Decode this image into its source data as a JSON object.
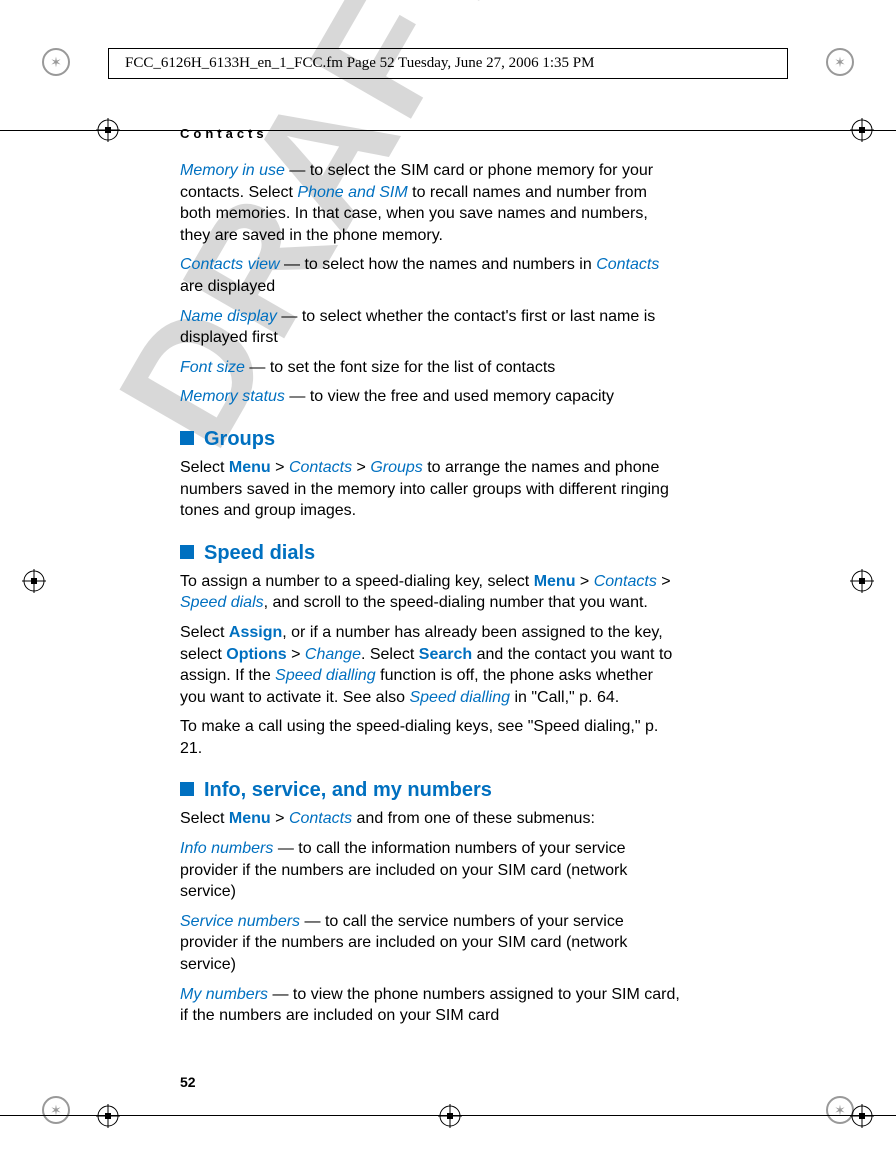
{
  "header": {
    "doc_line": "FCC_6126H_6133H_en_1_FCC.fm  Page 52  Tuesday, June 27, 2006  1:35 PM"
  },
  "section_header": "Contacts",
  "watermark": "DRAFT",
  "page_number": "52",
  "body": {
    "memory_in_use": {
      "label": "Memory in use",
      "text": " — to select the SIM card or phone memory for your contacts. Select ",
      "phone_and_sim": "Phone and SIM",
      "text2": " to recall names and number from both memories. In that case, when you save names and numbers, they are saved in the phone memory."
    },
    "contacts_view": {
      "label": "Contacts view",
      "text": " — to select how the names and numbers in ",
      "contacts_label": "Contacts",
      "text2": " are displayed"
    },
    "name_display": {
      "label": "Name display",
      "text": " — to select whether the contact's first or last name is displayed first"
    },
    "font_size": {
      "label": "Font size",
      "text": " — to set the font size for the list of contacts"
    },
    "memory_status": {
      "label": "Memory status",
      "text": " — to view the free and used memory capacity"
    },
    "groups": {
      "heading": "Groups",
      "select_label": "Select ",
      "menu": "Menu",
      "gt1": " > ",
      "contacts": "Contacts",
      "gt2": " > ",
      "groups_label": "Groups",
      "text": " to arrange the names and phone numbers saved in the memory into caller groups with different ringing tones and group images."
    },
    "speed_dials": {
      "heading": "Speed dials",
      "p1_a": "To assign a number to a speed-dialing key, select ",
      "menu": "Menu",
      "gt1": " > ",
      "contacts": "Contacts",
      "gt2": " > ",
      "sd_label": "Speed dials",
      "p1_b": ", and scroll to the speed-dialing number that you want.",
      "p2_a": "Select ",
      "assign": "Assign",
      "p2_b": ", or if a number has already been assigned to the key, select ",
      "options": "Options",
      "gt3": " > ",
      "change": "Change",
      "p2_c": ". Select ",
      "search": "Search",
      "p2_d": " and the contact you want to assign. If the ",
      "speed_dialling": "Speed dialling",
      "p2_e": " function is off, the phone asks whether you want to activate it. See also ",
      "speed_dialling2": "Speed dialling",
      "p2_f": " in \"Call,\" p. 64.",
      "p3": "To make a call using the speed-dialing keys, see \"Speed dialing,\" p. 21."
    },
    "info": {
      "heading": "Info, service, and my numbers",
      "p1_a": "Select ",
      "menu": "Menu",
      "gt1": " > ",
      "contacts": "Contacts",
      "p1_b": " and from one of these submenus:",
      "info_numbers": "Info numbers",
      "p2": " — to call the information numbers of your service provider if the numbers are included on your SIM card (network service)",
      "service_numbers": "Service numbers",
      "p3": " — to call the service numbers of your service provider if the numbers are included on your SIM card (network service)",
      "my_numbers": "My numbers",
      "p4": " — to view the phone numbers assigned to your SIM card, if the numbers are included on your SIM card"
    }
  }
}
